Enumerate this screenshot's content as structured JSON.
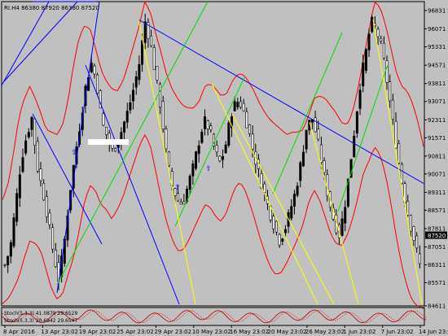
{
  "chart_data": {
    "type": "candlestick",
    "symbol_header": "RI.H4 86380 87920 86380 87520",
    "current_price_label": "87520",
    "current_price": 87520,
    "price_ticks": [
      96831,
      96071,
      95331,
      94571,
      93811,
      93071,
      92311,
      91571,
      90811,
      90071,
      89311,
      88571,
      87811,
      87051,
      86311,
      85571,
      84611
    ],
    "ylim": [
      84611,
      96831
    ],
    "x_ticks": [
      "8 Apr 2016",
      "13 Apr 23:02",
      "19 Apr 23:02",
      "25 Apr 23:02",
      "29 Apr 23:02",
      "10 May 23:02",
      "16 May 23:02",
      "20 May 23:02",
      "26 May 23:02",
      "1 Jun 23:02",
      "7 Jun 23:02",
      "14 Jun 23:02"
    ],
    "close_path": [
      86300,
      87000,
      88800,
      90600,
      91600,
      92400,
      90400,
      89400,
      88200,
      86800,
      85700,
      87200,
      89200,
      90800,
      92200,
      93700,
      94700,
      93900,
      92200,
      91600,
      91000,
      91400,
      92100,
      92800,
      93700,
      94700,
      96400,
      95500,
      94100,
      92700,
      90800,
      89600,
      89000,
      88800,
      89600,
      90400,
      91400,
      92300,
      91900,
      91000,
      90500,
      91300,
      92600,
      93100,
      92900,
      92100,
      91100,
      90200,
      89400,
      88600,
      87900,
      87300,
      87800,
      88600,
      89400,
      90600,
      92000,
      92400,
      91500,
      90300,
      89100,
      88200,
      87500,
      88600,
      90300,
      92100,
      93900,
      95100,
      96400,
      96000,
      95200,
      93800,
      92200,
      90700,
      89300,
      88200,
      87300,
      86300
    ],
    "band_upper": [
      89000,
      89600,
      90900,
      92400,
      93200,
      93700,
      93200,
      92600,
      91900,
      91800,
      91700,
      92100,
      93100,
      94600,
      95700,
      96200,
      96100,
      95300,
      94400,
      93900,
      93600,
      93500,
      93900,
      94600,
      95400,
      96200,
      97200,
      96800,
      95900,
      95100,
      94200,
      93600,
      93200,
      92900,
      92800,
      92800,
      93100,
      93700,
      93800,
      93600,
      93300,
      93400,
      93900,
      94200,
      94200,
      93900,
      93500,
      93000,
      92600,
      92300,
      92100,
      91900,
      91700,
      91800,
      91800,
      91900,
      92500,
      93200,
      93300,
      93200,
      92900,
      92600,
      92200,
      92100,
      92600,
      93600,
      94800,
      96000,
      97200,
      97000,
      96300,
      95300,
      94300,
      93700,
      93500,
      93000,
      92200,
      91200
    ],
    "band_lower": [
      84700,
      84900,
      85300,
      85800,
      86600,
      87300,
      87200,
      86900,
      86100,
      85300,
      84900,
      85100,
      85900,
      86600,
      87700,
      88900,
      89600,
      89400,
      88800,
      88600,
      88200,
      88600,
      89100,
      89800,
      90500,
      91200,
      91700,
      91300,
      90200,
      89100,
      88100,
      87400,
      86900,
      86900,
      87300,
      87800,
      88300,
      88800,
      88700,
      88300,
      88100,
      88500,
      89200,
      89700,
      89600,
      89000,
      88300,
      87500,
      86800,
      86200,
      85900,
      86000,
      86400,
      86900,
      87400,
      88000,
      88900,
      89400,
      89000,
      88300,
      87600,
      87200,
      87100,
      87500,
      88200,
      89100,
      90100,
      90600,
      91200,
      90900,
      90100,
      88900,
      87500,
      86300,
      85400,
      84800,
      84600,
      84500
    ],
    "indicator_label_1": "Stoch(5,3,3) 41.0879 29.6529",
    "indicator_label_2": "Stoch(5,3,3) 20.6942 29.6547",
    "colors": {
      "background": "#c0c0c0",
      "candle": "#000000",
      "bollinger": "#ff0000",
      "trend_blue": "#0000ff",
      "trend_green": "#00dd00",
      "trend_yellow": "#ffff00",
      "indicator_line": "#b00000",
      "indicator_dots": "#dd0000"
    }
  }
}
